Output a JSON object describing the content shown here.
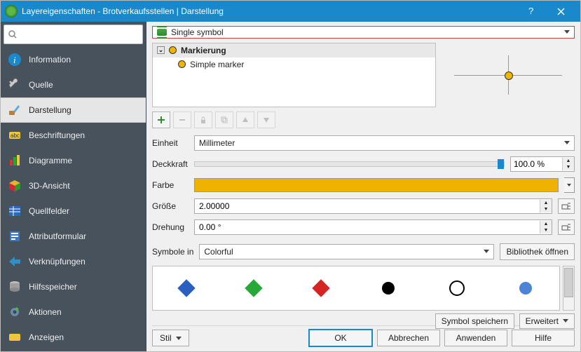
{
  "window": {
    "title": "Layereigenschaften - Brotverkaufsstellen | Darstellung"
  },
  "search": {
    "placeholder": ""
  },
  "sidebar": {
    "items": [
      {
        "key": "information",
        "label": "Information"
      },
      {
        "key": "source",
        "label": "Quelle"
      },
      {
        "key": "symbology",
        "label": "Darstellung",
        "active": true
      },
      {
        "key": "labels",
        "label": "Beschriftungen"
      },
      {
        "key": "diagrams",
        "label": "Diagramme"
      },
      {
        "key": "3dview",
        "label": "3D-Ansicht"
      },
      {
        "key": "sourcefields",
        "label": "Quellfelder"
      },
      {
        "key": "attributeform",
        "label": "Attributformular"
      },
      {
        "key": "joins",
        "label": "Verknüpfungen"
      },
      {
        "key": "auxstorage",
        "label": "Hilfsspeicher"
      },
      {
        "key": "actions",
        "label": "Aktionen"
      },
      {
        "key": "display",
        "label": "Anzeigen"
      }
    ]
  },
  "renderer": {
    "type": "Single symbol"
  },
  "tree": {
    "root": "Markierung",
    "child": "Simple marker"
  },
  "unit": {
    "label": "Einheit",
    "value": "Millimeter"
  },
  "opacity": {
    "label": "Deckkraft",
    "value": "100.0 %"
  },
  "color": {
    "label": "Farbe",
    "hex": "#f0b200"
  },
  "size": {
    "label": "Größe",
    "value": "2.00000"
  },
  "rotation": {
    "label": "Drehung",
    "value": "0.00 °"
  },
  "symbols": {
    "label": "Symbole in",
    "group": "Colorful",
    "library_btn": "Bibliothek öffnen"
  },
  "extra": {
    "save_symbol": "Symbol speichern",
    "advanced": "Erweitert"
  },
  "footer": {
    "style": "Stil",
    "ok": "OK",
    "cancel": "Abbrechen",
    "apply": "Anwenden",
    "help": "Hilfe"
  }
}
